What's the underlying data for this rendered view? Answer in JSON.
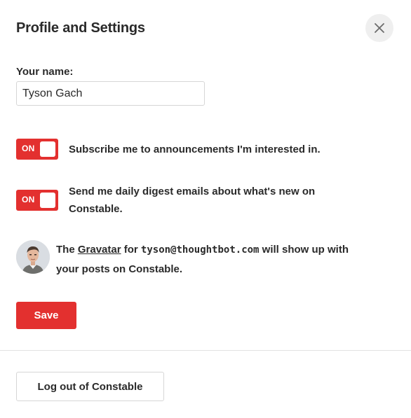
{
  "modal": {
    "title": "Profile and Settings",
    "close_icon": "close-icon"
  },
  "name_field": {
    "label": "Your name:",
    "value": "Tyson Gach"
  },
  "toggles": [
    {
      "state_label": "ON",
      "checked": true,
      "label_line1": "Subscribe me to announcements I'm interested in.",
      "label_line2": ""
    },
    {
      "state_label": "ON",
      "checked": true,
      "label_line1": "Send me daily digest emails about what's new on",
      "label_line2": "Constable."
    }
  ],
  "gravatar": {
    "prefix": "The",
    "link_text": "Gravatar",
    "middle": "for",
    "email": "tyson@thoughtbot.com",
    "suffix_line1": "will show up with",
    "suffix_line2": "your posts on Constable.",
    "avatar_icon": "user-avatar"
  },
  "actions": {
    "save_label": "Save",
    "logout_label": "Log out of Constable"
  },
  "colors": {
    "accent": "#e3302f",
    "text": "#2a2a2a",
    "border": "#d6d6d6",
    "close_bg": "#efefef"
  }
}
